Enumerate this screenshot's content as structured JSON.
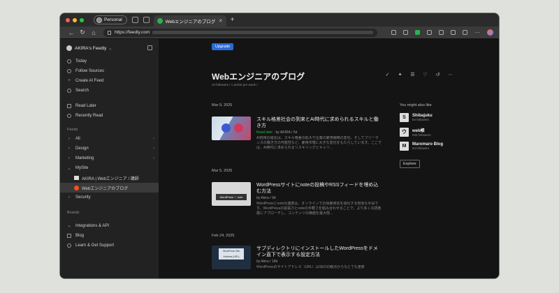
{
  "browser": {
    "profile_label": "Personal",
    "tab_title": "Webエンジニアのブログ",
    "url": "https://feedly.com"
  },
  "sidebar": {
    "account": "AKIRA's Feedly",
    "top_items": [
      {
        "label": "Today",
        "icon": "today-icon"
      },
      {
        "label": "Follow Sources",
        "icon": "follow-icon"
      },
      {
        "label": "Create AI Feed",
        "icon": "plus-icon"
      },
      {
        "label": "Search",
        "icon": "search-icon"
      }
    ],
    "read_items": [
      {
        "label": "Read Later",
        "icon": "bookmark-icon"
      },
      {
        "label": "Recently Read",
        "icon": "clock-icon"
      }
    ],
    "feeds_header": "Feeds",
    "feeds": [
      "All",
      "Design",
      "Marketing",
      "MySite"
    ],
    "mysite_children": [
      "AKIRA | Webエンジニア / 講師",
      "Webエンジニアのブログ"
    ],
    "security": "Security",
    "boards_header": "Boards",
    "bottom_items": [
      {
        "label": "Integrations & API",
        "icon": "plug-icon"
      },
      {
        "label": "Blog",
        "icon": "blog-icon"
      },
      {
        "label": "Learn & Get Support",
        "icon": "help-icon"
      }
    ]
  },
  "main": {
    "upgrade_label": "Upgrade",
    "title": "Webエンジニアのブログ",
    "meta": "10 followers / 1 article per week /",
    "sections": [
      {
        "date": "Mar 9, 2025",
        "title": "スキル格差社会の到来とAI時代に求められるスキルと働き方",
        "read_later": "Read later",
        "meta": "by AKIRA / 5d",
        "excerpt": "AI技術の進化は、スキル格差の拡大や企業の雇用戦略の変化、そしてフリーランスの働き方の可能性など、雇用市場に大きな変化をもたらしています。ここでは、AI時代に求められるリスキリングとキャリ..."
      },
      {
        "date": "Mar 5, 2025",
        "title": "WordPressサイトにnoteの投稿やRSSフィードを埋め込む方法",
        "meta": "by Akira / 9d",
        "excerpt": "WordPressとnoteの連携は、オンラインでの情報発信を強化する有効な手段です。WordPressの拡張力とnoteの手軽さを組み合わせることで、より多くの読者層にアプローチし、コンテンツの価値を最大限...",
        "thumb_text_a": "WordPress",
        "thumb_text_b": "note"
      },
      {
        "date": "Feb 24, 2025",
        "title": "サブディレクトリにインストールしたWordPressをドメイン直下で表示する設定方法",
        "meta": "by Akira / 18d",
        "excerpt": "WordPressのサイトアドレス（URL）はSEOの観点からもとても重要",
        "thumb_text": "WordPress Site Address (URL)"
      }
    ],
    "suggest": {
      "header": "You might also like",
      "items": [
        {
          "name": "Shibajuku",
          "followers": "84 followers",
          "logo": "S"
        },
        {
          "name": "web帳",
          "followers": "945 followers",
          "logo": "ウ"
        },
        {
          "name": "Maromaro Blog",
          "followers": "63 followers",
          "logo": "M"
        }
      ],
      "explore": "Explore"
    }
  }
}
